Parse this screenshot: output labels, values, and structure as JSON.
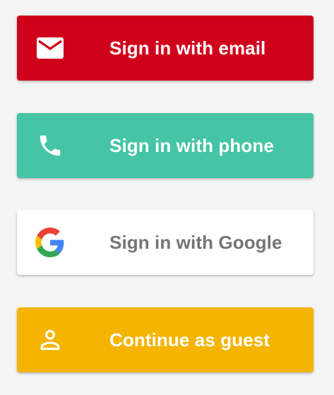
{
  "buttons": {
    "email": {
      "label": "Sign in with email",
      "icon": "mail-icon",
      "background": "#d0011b",
      "text_color": "#ffffff"
    },
    "phone": {
      "label": "Sign in with phone",
      "icon": "phone-icon",
      "background": "#45c5a5",
      "text_color": "#ffffff"
    },
    "google": {
      "label": "Sign in with Google",
      "icon": "google-icon",
      "background": "#ffffff",
      "text_color": "#757575"
    },
    "guest": {
      "label": "Continue as guest",
      "icon": "person-icon",
      "background": "#f4b400",
      "text_color": "#ffffff"
    }
  }
}
